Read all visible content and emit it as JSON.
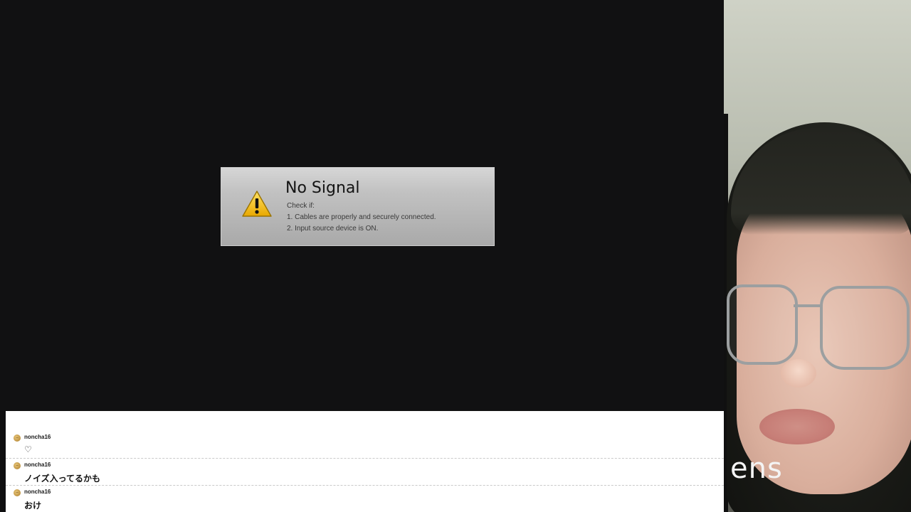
{
  "no_signal": {
    "title": "No Signal",
    "lines": [
      "Check if:",
      "1. Cables are properly and securely connected.",
      "2. Input source device is ON."
    ],
    "icon": "warning-triangle-icon",
    "warning_color": "#f2c20f"
  },
  "webcam": {
    "overlay_text": "ens"
  },
  "chat": {
    "messages": [
      {
        "username": "noncha16",
        "text": "♡"
      },
      {
        "username": "noncha16",
        "text": "ノイズ入ってるかも"
      },
      {
        "username": "noncha16",
        "text": "おけ"
      }
    ],
    "avatar_icon": "user-avatar-icon"
  }
}
